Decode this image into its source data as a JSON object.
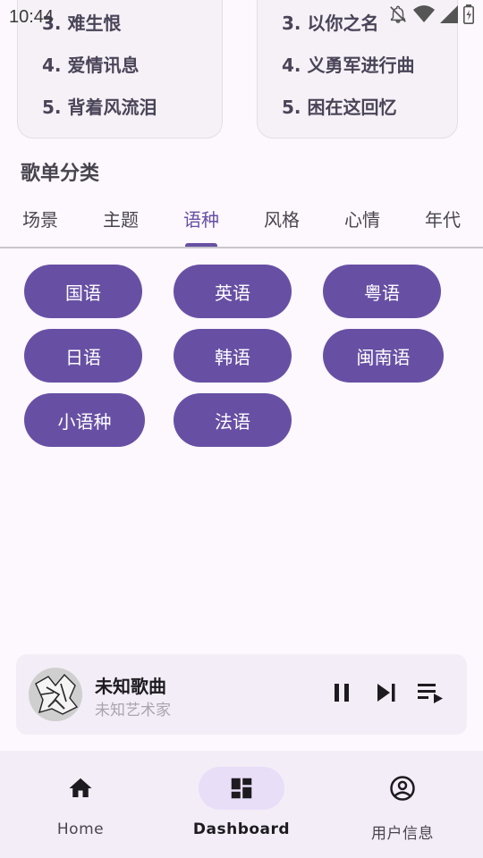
{
  "status_bar": {
    "time": "10:44"
  },
  "rank_cards": {
    "left": [
      "3. 难生恨",
      "4. 爱情讯息",
      "5. 背着风流泪"
    ],
    "right": [
      "3. 以你之名",
      "4. 义勇军进行曲",
      "5. 困在这回忆"
    ]
  },
  "section": {
    "title": "歌单分类"
  },
  "tabs": [
    {
      "label": "场景"
    },
    {
      "label": "主题"
    },
    {
      "label": "语种"
    },
    {
      "label": "风格"
    },
    {
      "label": "心情"
    },
    {
      "label": "年代"
    }
  ],
  "active_tab": "语种",
  "chips": [
    "国语",
    "英语",
    "粤语",
    "日语",
    "韩语",
    "闽南语",
    "小语种",
    "法语"
  ],
  "player": {
    "title": "未知歌曲",
    "artist": "未知艺术家"
  },
  "bottom_nav": {
    "items": [
      {
        "label": "Home",
        "icon": "home-icon"
      },
      {
        "label": "Dashboard",
        "icon": "dashboard-icon"
      },
      {
        "label": "用户信息",
        "icon": "account-circle-icon"
      }
    ],
    "active": "Dashboard"
  },
  "colors": {
    "accent": "#6750a4",
    "background": "#fdf7fe",
    "nav_background": "#f3edf7",
    "nav_active_pill": "#e8def8"
  }
}
